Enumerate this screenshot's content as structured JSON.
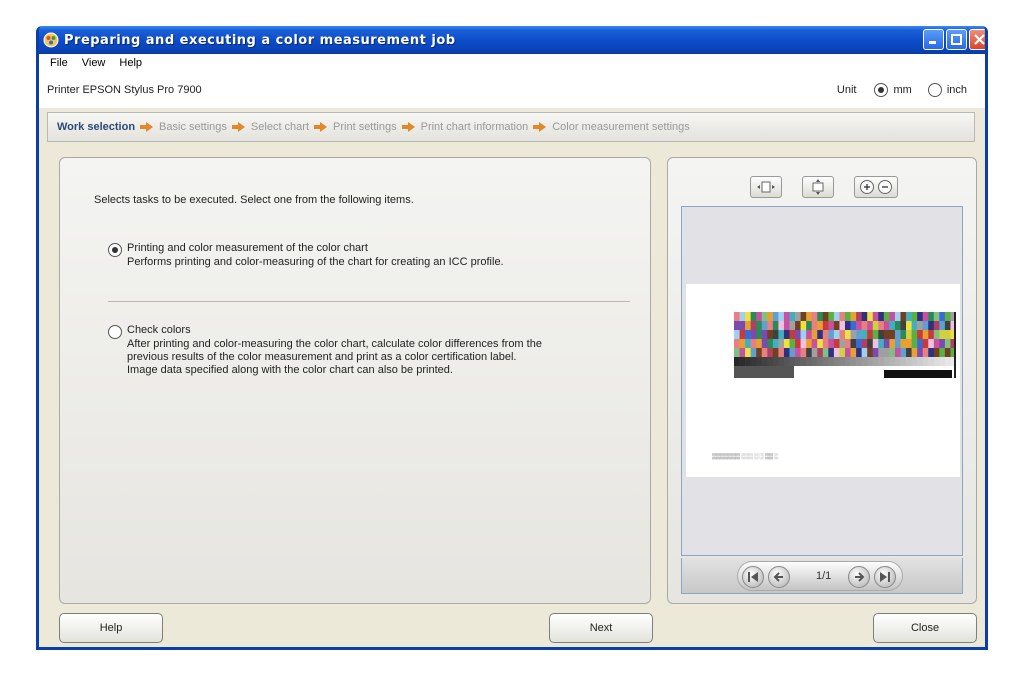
{
  "window": {
    "title": "Preparing and executing a color measurement job"
  },
  "menu": [
    "File",
    "View",
    "Help"
  ],
  "printer": {
    "label": "Printer EPSON Stylus Pro 7900"
  },
  "unit": {
    "label": "Unit",
    "options": [
      "mm",
      "inch"
    ],
    "selected": "mm"
  },
  "steps": [
    "Work selection",
    "Basic settings",
    "Select chart",
    "Print settings",
    "Print chart information",
    "Color measurement settings"
  ],
  "active_step": "Work selection",
  "content": {
    "intro": "Selects tasks to be executed. Select one from the following items.",
    "options": [
      {
        "title": "Printing and color measurement of the color chart",
        "desc": [
          "Performs printing and color-measuring of the chart for creating an ICC profile."
        ],
        "selected": true
      },
      {
        "title": "Check colors",
        "desc": [
          "After printing and color-measuring the color chart, calculate color differences from the",
          "previous results of the color measurement and print as a color certification label.",
          "Image data specified along with the color chart can also be printed."
        ],
        "selected": false
      }
    ]
  },
  "preview": {
    "page": "1/1",
    "tool_icons": [
      "fit-width-icon",
      "fit-height-icon",
      "zoom-in-icon",
      "zoom-out-icon"
    ],
    "nav_icons": [
      "first-page-icon",
      "prev-page-icon",
      "next-page-icon",
      "last-page-icon"
    ]
  },
  "buttons": {
    "help": "Help",
    "next": "Next",
    "close": "Close"
  },
  "colors": {
    "title_bar": "#0c4bc8",
    "step_arrow": "#e0882a",
    "active_step": "#2a4a7a",
    "inactive_step": "#999999"
  }
}
